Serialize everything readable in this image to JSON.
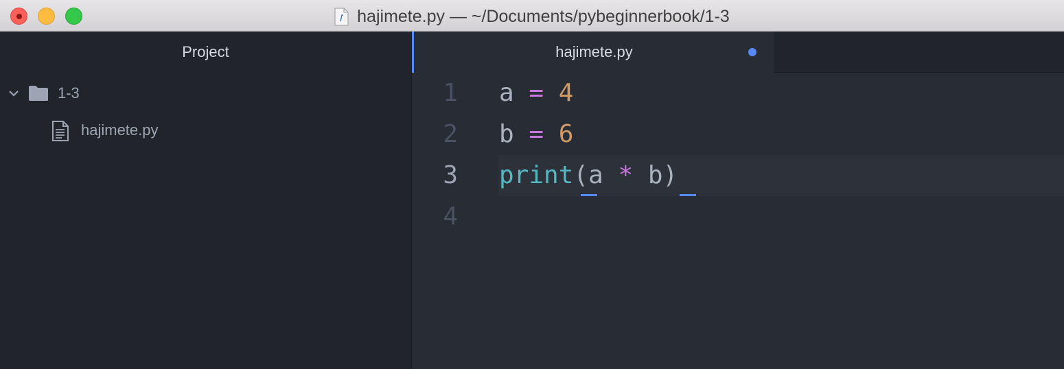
{
  "window": {
    "title": "hajimete.py — ~/Documents/pybeginnerbook/1-3"
  },
  "sidebar": {
    "header": "Project",
    "tree": {
      "folder_label": "1-3",
      "file_label": "hajimete.py"
    }
  },
  "editor": {
    "tab_label": "hajimete.py",
    "line_numbers": [
      "1",
      "2",
      "3",
      "4"
    ],
    "lines": [
      [
        {
          "t": "a",
          "k": "var"
        },
        {
          "t": " ",
          "k": "sp"
        },
        {
          "t": "=",
          "k": "op"
        },
        {
          "t": " ",
          "k": "sp"
        },
        {
          "t": "4",
          "k": "num"
        }
      ],
      [
        {
          "t": "b",
          "k": "var"
        },
        {
          "t": " ",
          "k": "sp"
        },
        {
          "t": "=",
          "k": "op"
        },
        {
          "t": " ",
          "k": "sp"
        },
        {
          "t": "6",
          "k": "num"
        }
      ],
      [
        {
          "t": "print",
          "k": "fn"
        },
        {
          "t": "(",
          "k": "punc"
        },
        {
          "t": "a",
          "k": "var"
        },
        {
          "t": " ",
          "k": "sp"
        },
        {
          "t": "*",
          "k": "op"
        },
        {
          "t": " ",
          "k": "sp"
        },
        {
          "t": "b",
          "k": "var"
        },
        {
          "t": ")",
          "k": "punc"
        }
      ],
      []
    ]
  },
  "colors": {
    "accent": "#568af2",
    "keyword_op": "#c678dd",
    "number": "#d19a66",
    "builtin": "#56b6c2",
    "text": "#abb2bf"
  },
  "icons": {
    "close": "close-icon",
    "minimize": "minimize-icon",
    "maximize": "maximize-icon",
    "title_file": "python-file-icon",
    "chevron": "chevron-down-icon",
    "folder": "folder-icon",
    "file": "file-text-icon"
  }
}
